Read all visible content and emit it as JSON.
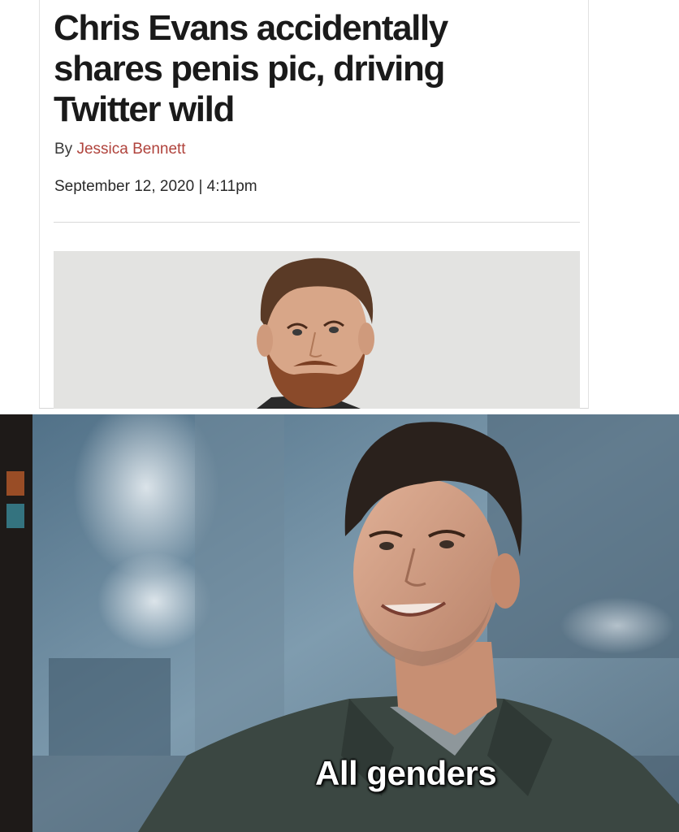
{
  "article": {
    "headline": "Chris Evans accidentally shares penis pic, driving Twitter wild",
    "byline_prefix": "By ",
    "author": "Jessica Bennett",
    "dateline": "September 12, 2020 | 4:11pm"
  },
  "meme": {
    "caption": "All genders"
  },
  "colors": {
    "author_link": "#b0433c",
    "headline": "#1a1a1a",
    "caption_text": "#ffffff"
  }
}
